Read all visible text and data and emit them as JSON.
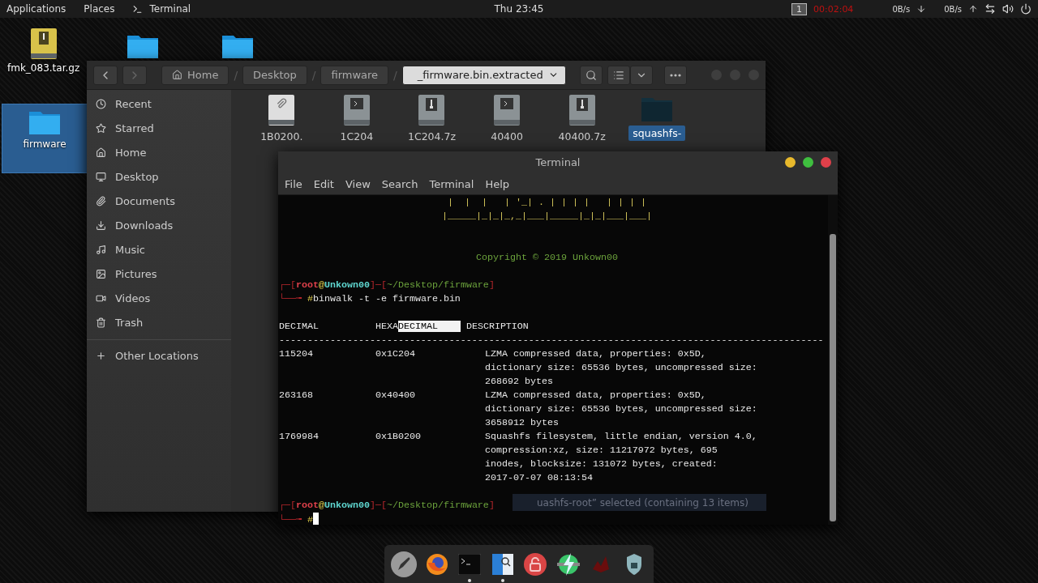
{
  "top_bar": {
    "menus": [
      "Applications",
      "Places"
    ],
    "app": "Terminal",
    "clock": "Thu 23:45",
    "workspace": "1",
    "recorder": "00:02:04",
    "down_rate": "0B/s",
    "up_rate": "0B/s"
  },
  "desktop_icons": [
    {
      "kind": "archive",
      "label": "fmk_083.tar.gz",
      "selected": false
    },
    {
      "kind": "folder",
      "selected": false
    },
    {
      "kind": "folder",
      "selected": false
    },
    {
      "kind": "folder",
      "label": "firmware",
      "selected": true
    }
  ],
  "file_manager": {
    "path": [
      {
        "label": "Home",
        "selected": false
      },
      {
        "label": "Desktop",
        "selected": false
      },
      {
        "label": "firmware",
        "selected": false
      },
      {
        "label": "_firmware.bin.extracted",
        "selected": true
      }
    ],
    "separator": "/",
    "sidebar": [
      "Recent",
      "Starred",
      "Home",
      "Desktop",
      "Documents",
      "Downloads",
      "Music",
      "Pictures",
      "Videos",
      "Trash"
    ],
    "other_locations": "Other Locations",
    "files": [
      {
        "kind": "text",
        "name": "1B0200.",
        "selected": false
      },
      {
        "kind": "run",
        "name": "1C204",
        "selected": false
      },
      {
        "kind": "archive",
        "name": "1C204.7z",
        "selected": false
      },
      {
        "kind": "run",
        "name": "40400",
        "selected": false
      },
      {
        "kind": "archive",
        "name": "40400.7z",
        "selected": false
      },
      {
        "kind": "folder",
        "name": "squashfs-",
        "selected": true
      }
    ],
    "status": "uashfs-root” selected (containing 13 items)"
  },
  "terminal": {
    "title": "Terminal",
    "menu": [
      "File",
      "Edit",
      "View",
      "Search",
      "Terminal",
      "Help"
    ],
    "banner": [
      "|  |  |   | '_| . | | | |   | | | |",
      "|_____|_|_|_,_|___|_____|_|_|___|___|"
    ],
    "copyright": "Copyright © 2019 Unkown00",
    "prompts": [
      {
        "open": "┌─[",
        "user": "root",
        "at": "@",
        "host": "Unkown00",
        "mid": "]─[",
        "path": "~/Desktop/firmware",
        "close": "]",
        "arrow": "└──╼ ",
        "hash": "#",
        "command": "binwalk -t -e firmware.bin"
      },
      {
        "open": "┌─[",
        "user": "root",
        "at": "@",
        "host": "Unkown00",
        "mid": "]─[",
        "path": "~/Desktop/firmware",
        "close": "]",
        "arrow": "└──╼ ",
        "hash": "#"
      }
    ],
    "header": [
      {
        "text": "DECIMAL",
        "highlighted": false
      },
      {
        "text": "HEXA",
        "highlighted": false
      },
      {
        "text": "DECIMAL    ",
        "highlighted": true
      },
      {
        "text": "DESCRIPTION",
        "highlighted": false
      }
    ],
    "rule": "------------------------------------------------------------------------------------------------",
    "rows": [
      {
        "decimal": "115204",
        "hex": "0x1C204",
        "description": [
          "LZMA compressed data, properties: 0x5D,",
          "dictionary size: 65536 bytes, uncompressed size:",
          "268692 bytes"
        ]
      },
      {
        "decimal": "263168",
        "hex": "0x40400",
        "description": [
          "LZMA compressed data, properties: 0x5D,",
          "dictionary size: 65536 bytes, uncompressed size:",
          "3658912 bytes"
        ]
      },
      {
        "decimal": "1769984",
        "hex": "0x1B0200",
        "description": [
          "Squashfs filesystem, little endian, version 4.0,",
          "compression:xz, size: 11217972 bytes, 695",
          "inodes, blocksize: 131072 bytes, created:",
          "2017-07-07 08:13:54"
        ]
      }
    ]
  },
  "dock": [
    {
      "kind": "rocket",
      "running": false
    },
    {
      "kind": "browser",
      "running": false
    },
    {
      "kind": "terminal",
      "running": true
    },
    {
      "kind": "finder",
      "running": true
    },
    {
      "kind": "padlock",
      "running": false
    },
    {
      "kind": "lightning",
      "running": false
    },
    {
      "kind": "splash",
      "running": false
    },
    {
      "kind": "shield",
      "running": false
    }
  ]
}
